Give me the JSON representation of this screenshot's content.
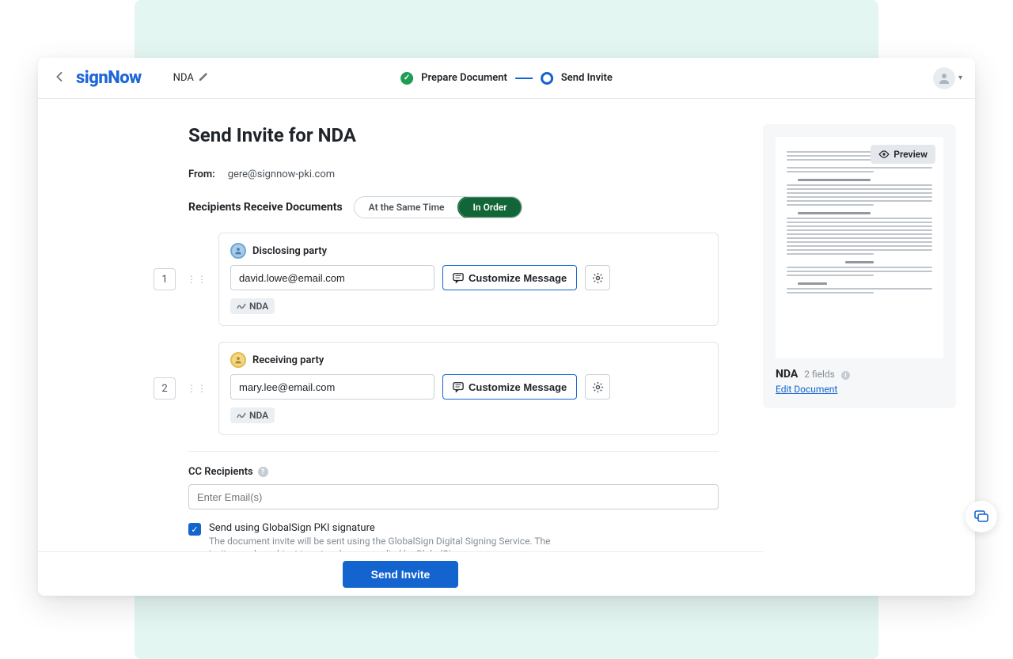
{
  "header": {
    "logo": "signNow",
    "doc_name": "NDA",
    "steps": {
      "prepare": "Prepare Document",
      "send": "Send Invite"
    }
  },
  "page": {
    "title": "Send Invite for NDA",
    "from_label": "From:",
    "from_value": "gere@signnow-pki.com",
    "recipients_label": "Recipients Receive Documents",
    "toggle": {
      "same_time": "At the Same Time",
      "in_order": "In Order"
    }
  },
  "recipients": [
    {
      "order": "1",
      "role": "Disclosing party",
      "email": "david.lowe@email.com",
      "customize_label": "Customize Message",
      "tag": "NDA",
      "role_color": "blue"
    },
    {
      "order": "2",
      "role": "Receiving party",
      "email": "mary.lee@email.com",
      "customize_label": "Customize Message",
      "tag": "NDA",
      "role_color": "yellow"
    }
  ],
  "cc": {
    "label": "CC Recipients",
    "placeholder": "Enter Email(s)"
  },
  "pki": {
    "label": "Send using GlobalSign PKI signature",
    "description": "The document invite will be sent using the GlobalSign Digital Signing Service. The invite may be subject to extra charges applied by GlobalSign."
  },
  "actions": {
    "send": "Send Invite"
  },
  "preview": {
    "button": "Preview",
    "doc_name": "NDA",
    "fields": "2 fields",
    "edit": "Edit Document"
  }
}
